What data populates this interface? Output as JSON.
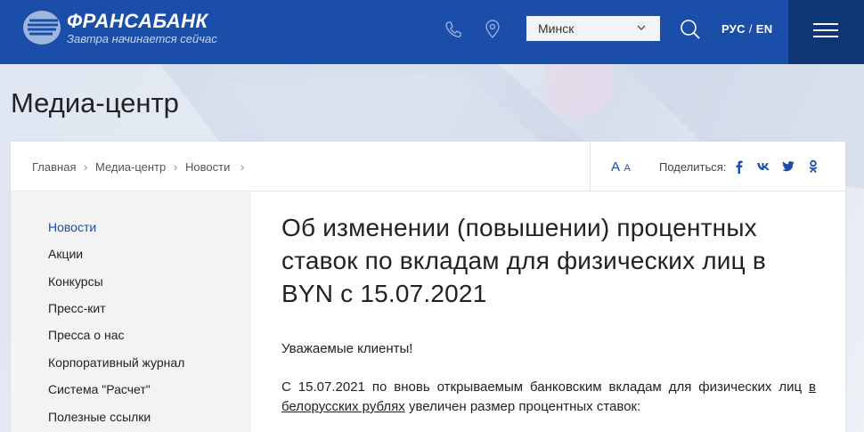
{
  "header": {
    "logo_name": "ФРАНСАБАНК",
    "logo_slogan": "Завтра начинается сейчас",
    "city": "Минск",
    "lang_active": "РУС",
    "lang_sep": "/",
    "lang_other": "EN",
    "brand_color": "#1b4ea8"
  },
  "page": {
    "title": "Медиа-центр"
  },
  "breadcrumb": {
    "items": [
      "Главная",
      "Медиа-центр",
      "Новости"
    ],
    "sep": "›"
  },
  "tools": {
    "font_big": "A",
    "font_small": "A",
    "share_label": "Поделиться:"
  },
  "sidebar": {
    "items": [
      {
        "label": "Новости",
        "active": true
      },
      {
        "label": "Акции"
      },
      {
        "label": "Конкурсы"
      },
      {
        "label": "Пресс-кит"
      },
      {
        "label": "Пресса о нас"
      },
      {
        "label": "Корпоративный журнал"
      },
      {
        "label": "Система \"Расчет\""
      },
      {
        "label": "Полезные ссылки"
      }
    ]
  },
  "article": {
    "headline": "Об изменении (повышении) процентных ставок по вкладам для физических лиц в BYN с 15.07.2021",
    "greeting": "Уважаемые клиенты!",
    "para_before": "С 15.07.2021 по вновь открываемым банковским вкладам для физических лиц ",
    "para_link": "в белорусских рублях",
    "para_after": " увеличен размер процентных ставок:"
  }
}
